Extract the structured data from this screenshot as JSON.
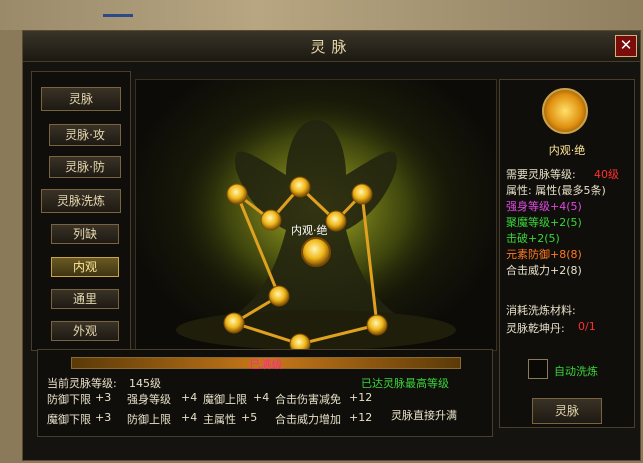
{
  "window": {
    "title": "灵脉",
    "close": "✕"
  },
  "left_buttons": {
    "lingmai": "灵脉",
    "attack": "灵脉·攻",
    "defense": "灵脉·防",
    "refine": "灵脉洗炼",
    "liejue": "列缺",
    "neiguan": "内观",
    "tongli": "通里",
    "waiguan": "外观"
  },
  "node_label": "内观·绝",
  "right_panel": {
    "name": "内观·绝",
    "req_label": "需要灵脉等级:",
    "req_value": "40级",
    "attr_line": "属性: 属性(最多5条)",
    "attrs": [
      {
        "text": "强身等级+4(5)",
        "color": "#e04ae0"
      },
      {
        "text": "聚魔等级+2(5)",
        "color": "#3ad43a"
      },
      {
        "text": "击破+2(5)",
        "color": "#3ad43a"
      },
      {
        "text": "元素防御+8(8)",
        "color": "#ff7a20"
      },
      {
        "text": "合击威力+2(8)",
        "color": "#e8e0c8"
      }
    ],
    "material_label": "消耗洗炼材料:",
    "material_name": "灵脉乾坤丹:",
    "material_count": "0/1",
    "auto_refine": "自动洗炼",
    "action_button": "灵脉"
  },
  "bottom": {
    "bar_label": "已满级",
    "level_label": "当前灵脉等级:",
    "level_value": "145级",
    "max_text": "已达灵脉最高等级",
    "stats_row1": [
      {
        "label": "防御下限",
        "value": "+3"
      },
      {
        "label": "强身等级",
        "value": "+4"
      },
      {
        "label": "魔御上限",
        "value": "+4"
      },
      {
        "label": "合击伤害减免",
        "value": "+12"
      }
    ],
    "stats_row2": [
      {
        "label": "魔御下限",
        "value": "+3"
      },
      {
        "label": "防御上限",
        "value": "+4"
      },
      {
        "label": "主属性",
        "value": "+5"
      },
      {
        "label": "合击威力增加",
        "value": "+12"
      }
    ],
    "upgrade_link": "灵脉直接升满"
  },
  "colors": {
    "accent_gold": "#c9a24a",
    "max_green": "#3ad43a",
    "req_red": "#ff3030"
  }
}
